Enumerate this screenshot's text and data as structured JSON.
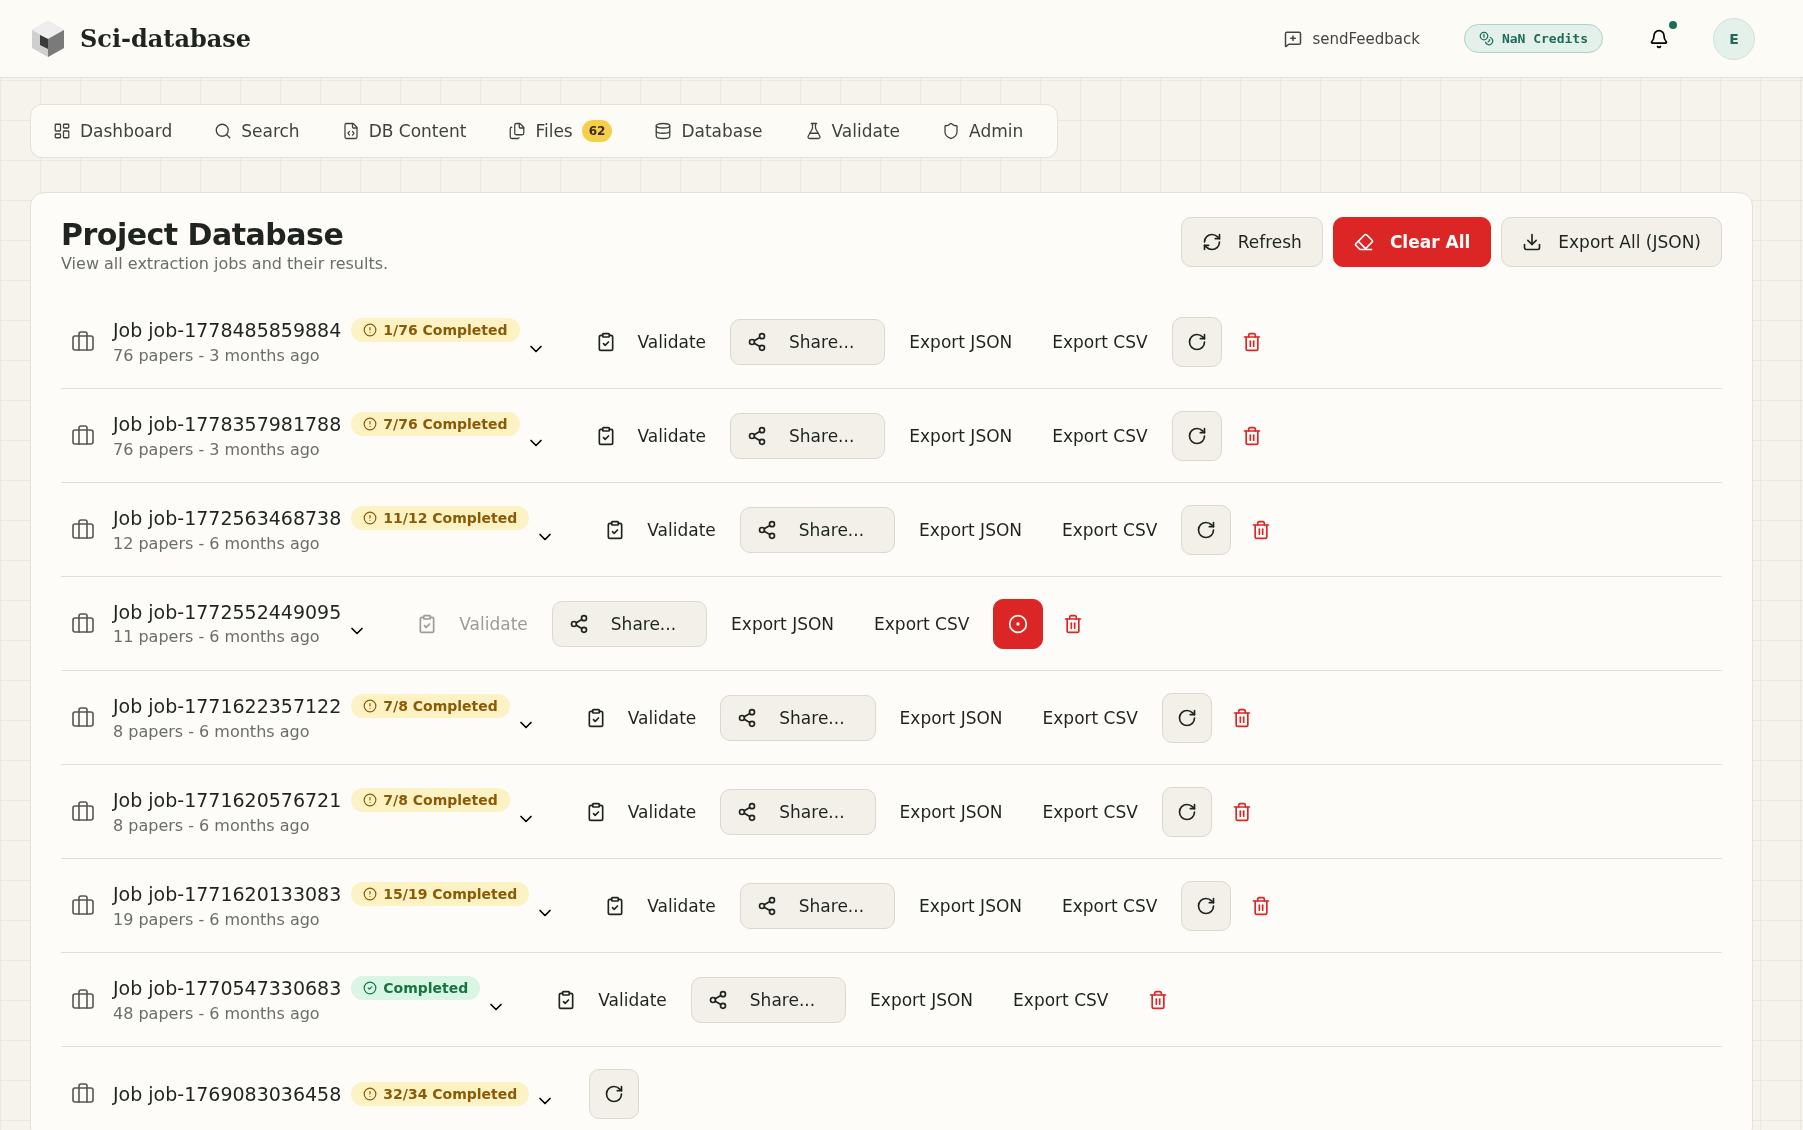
{
  "app": {
    "title": "Sci-database",
    "feedback": "sendFeedback",
    "credits": "NaN Credits",
    "avatar": "E",
    "unread": true
  },
  "tabs": [
    {
      "label": "Dashboard",
      "selected": false
    },
    {
      "label": "Search",
      "selected": false
    },
    {
      "label": "DB Content",
      "selected": false
    },
    {
      "label": "Files",
      "selected": false,
      "count": "62"
    },
    {
      "label": "Database",
      "selected": false
    },
    {
      "label": "Validate",
      "selected": false
    },
    {
      "label": "Admin",
      "selected": false
    }
  ],
  "panel": {
    "title": "Project Database",
    "subtitle": "View all extraction jobs and their results.",
    "buttons": [
      {
        "label": "Refresh",
        "kind": "refresh"
      },
      {
        "label": "Clear All",
        "kind": "clear"
      },
      {
        "label": "Export All (JSON)",
        "kind": "export"
      }
    ]
  },
  "jobs": [
    {
      "name": "Job job-1778485859884",
      "meta": "76 papers - 3 months ago",
      "badge": {
        "kind": "partial",
        "label": "1/76 Completed"
      },
      "validate": "Validate",
      "validate_disabled": false,
      "share": "Share...",
      "export_json": "Export JSON",
      "export_csv": "Export CSV",
      "action_button": {
        "kind": "retry"
      }
    },
    {
      "name": "Job job-1778357981788",
      "meta": "76 papers - 3 months ago",
      "badge": {
        "kind": "partial",
        "label": "7/76 Completed"
      },
      "validate": "Validate",
      "validate_disabled": false,
      "share": "Share...",
      "export_json": "Export JSON",
      "export_csv": "Export CSV",
      "action_button": {
        "kind": "retry"
      }
    },
    {
      "name": "Job job-1772563468738",
      "meta": "12 papers - 6 months ago",
      "badge": {
        "kind": "partial",
        "label": "11/12 Completed"
      },
      "validate": "Validate",
      "validate_disabled": false,
      "share": "Share...",
      "export_json": "Export JSON",
      "export_csv": "Export CSV",
      "action_button": {
        "kind": "retry"
      }
    },
    {
      "name": "Job job-1772552449095",
      "meta": "11 papers - 6 months ago",
      "validate": "Validate",
      "validate_disabled": true,
      "share": "Share...",
      "export_json": "Export JSON",
      "export_csv": "Export CSV",
      "action_button": {
        "kind": "stop"
      }
    },
    {
      "name": "Job job-1771622357122",
      "meta": "8 papers - 6 months ago",
      "badge": {
        "kind": "partial",
        "label": "7/8 Completed"
      },
      "validate": "Validate",
      "validate_disabled": false,
      "share": "Share...",
      "export_json": "Export JSON",
      "export_csv": "Export CSV",
      "action_button": {
        "kind": "retry"
      }
    },
    {
      "name": "Job job-1771620576721",
      "meta": "8 papers - 6 months ago",
      "badge": {
        "kind": "partial",
        "label": "7/8 Completed"
      },
      "validate": "Validate",
      "validate_disabled": false,
      "share": "Share...",
      "export_json": "Export JSON",
      "export_csv": "Export CSV",
      "action_button": {
        "kind": "retry"
      }
    },
    {
      "name": "Job job-1771620133083",
      "meta": "19 papers - 6 months ago",
      "badge": {
        "kind": "partial",
        "label": "15/19 Completed"
      },
      "validate": "Validate",
      "validate_disabled": false,
      "share": "Share...",
      "export_json": "Export JSON",
      "export_csv": "Export CSV",
      "action_button": {
        "kind": "retry"
      }
    },
    {
      "name": "Job job-1770547330683",
      "meta": "48 papers - 6 months ago",
      "badge": {
        "kind": "completed",
        "label": "Completed"
      },
      "validate": "Validate",
      "validate_disabled": false,
      "share": "Share...",
      "export_json": "Export JSON",
      "export_csv": "Export CSV"
    },
    {
      "name": "Job job-1769083036458",
      "badge": {
        "kind": "partial",
        "label": "32/34 Completed"
      },
      "action_button": {
        "kind": "retry"
      }
    }
  ]
}
